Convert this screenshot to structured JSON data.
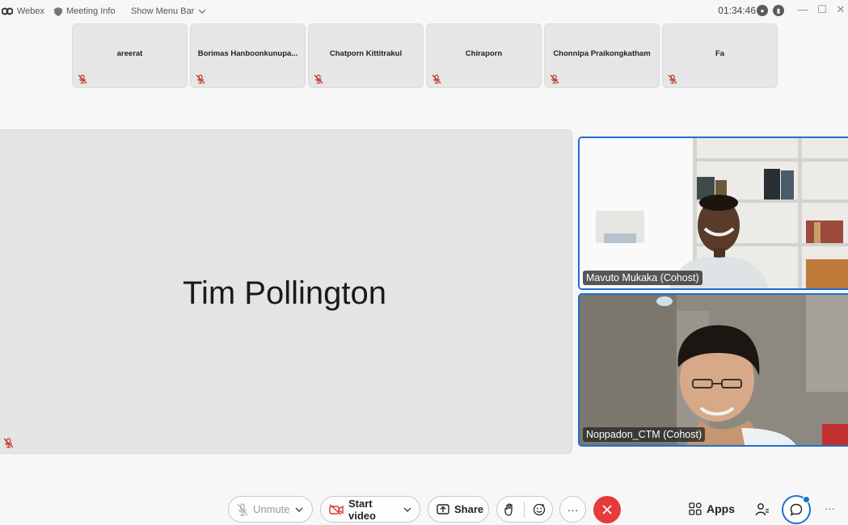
{
  "titlebar": {
    "app_name": "Webex",
    "meeting_info": "Meeting Info",
    "show_menu_bar": "Show Menu Bar",
    "time": "01:34:46"
  },
  "thumbnails": [
    {
      "name": "areerat"
    },
    {
      "name": "Borimas Hanboonkunupa..."
    },
    {
      "name": "Chatporn Kittitrakul"
    },
    {
      "name": "Chiraporn"
    },
    {
      "name": "Chonnipa Praikongkatham"
    },
    {
      "name": "Fa"
    }
  ],
  "stage": {
    "speaker_name": "Tim Pollington"
  },
  "videos": [
    {
      "label": "Mavuto Mukaka (Cohost)"
    },
    {
      "label": "Noppadon_CTM (Cohost)"
    }
  ],
  "toolbar": {
    "unmute_label": "Unmute",
    "start_video_label": "Start video",
    "share_label": "Share",
    "more_label": "···",
    "apps_label": "Apps",
    "overflow_label": "···"
  },
  "colors": {
    "accent": "#1e6fd0",
    "end_call": "#e63b3b",
    "mic_muted": "#c0392b"
  }
}
